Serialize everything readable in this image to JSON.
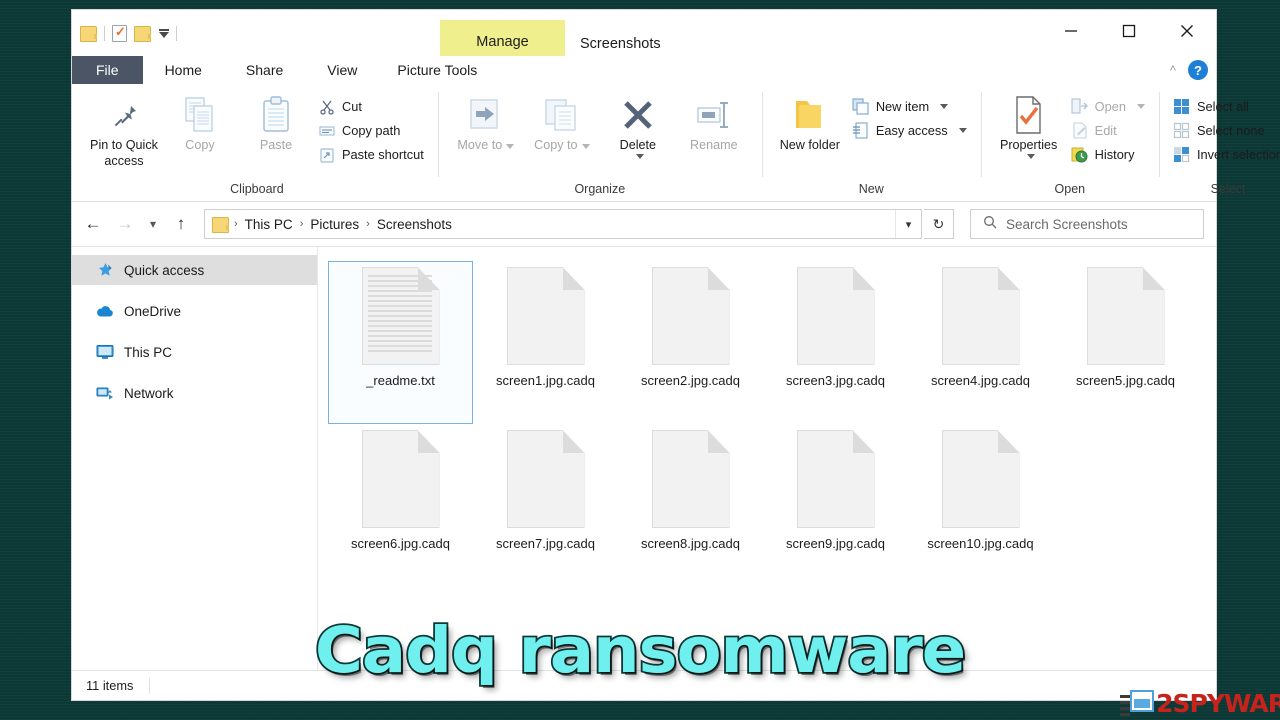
{
  "window": {
    "title": "Screenshots",
    "manage_band": "Manage",
    "controls": {
      "minimize": "minimize-button",
      "maximize": "maximize-button",
      "close": "close-button"
    },
    "quick_access": [
      {
        "name": "folder-icon"
      },
      {
        "name": "properties-icon"
      },
      {
        "name": "folder-icon"
      },
      {
        "name": "customize-dropdown-icon"
      }
    ]
  },
  "tabs": [
    {
      "label": "File",
      "type": "file"
    },
    {
      "label": "Home",
      "type": "tab",
      "active": true
    },
    {
      "label": "Share",
      "type": "tab"
    },
    {
      "label": "View",
      "type": "tab"
    },
    {
      "label": "Picture Tools",
      "type": "contextual"
    }
  ],
  "ribbon": {
    "collapse_icon": "chevron-up-icon",
    "help_icon": "help-icon",
    "help_label": "?",
    "groups": [
      {
        "label": "Clipboard",
        "big": [
          {
            "label": "Pin to Quick access",
            "icon": "pin-icon"
          },
          {
            "label": "Copy",
            "icon": "copy-icon",
            "dim": true
          },
          {
            "label": "Paste",
            "icon": "paste-icon",
            "dim": true
          }
        ],
        "small": [
          {
            "label": "Cut",
            "icon": "scissors-icon"
          },
          {
            "label": "Copy path",
            "icon": "copy-path-icon"
          },
          {
            "label": "Paste shortcut",
            "icon": "paste-shortcut-icon"
          }
        ]
      },
      {
        "label": "Organize",
        "big": [
          {
            "label": "Move to",
            "icon": "move-to-icon",
            "dim": true,
            "caret": true
          },
          {
            "label": "Copy to",
            "icon": "copy-to-icon",
            "dim": true,
            "caret": true
          },
          {
            "label": "Delete",
            "icon": "delete-icon",
            "caret_below": true
          },
          {
            "label": "Rename",
            "icon": "rename-icon",
            "dim": true
          }
        ]
      },
      {
        "label": "New",
        "big": [
          {
            "label": "New folder",
            "icon": "new-folder-icon"
          }
        ],
        "small": [
          {
            "label": "New item",
            "icon": "new-item-icon",
            "caret": true
          },
          {
            "label": "Easy access",
            "icon": "easy-access-icon",
            "caret": true
          }
        ]
      },
      {
        "label": "Open",
        "big": [
          {
            "label": "Properties",
            "icon": "properties-icon",
            "caret_below": true
          }
        ],
        "small": [
          {
            "label": "Open",
            "icon": "open-icon",
            "dim": true,
            "caret": true
          },
          {
            "label": "Edit",
            "icon": "edit-icon",
            "dim": true
          },
          {
            "label": "History",
            "icon": "history-icon"
          }
        ]
      },
      {
        "label": "Select",
        "small": [
          {
            "label": "Select all",
            "icon": "select-all-icon"
          },
          {
            "label": "Select none",
            "icon": "select-none-icon"
          },
          {
            "label": "Invert selection",
            "icon": "invert-selection-icon"
          }
        ]
      }
    ]
  },
  "addressbar": {
    "back_icon": "back-arrow-icon",
    "forward_icon": "forward-arrow-icon",
    "recent_icon": "recent-locations-icon",
    "up_icon": "up-arrow-icon",
    "folder_icon": "folder-icon",
    "breadcrumbs": [
      "This PC",
      "Pictures",
      "Screenshots"
    ],
    "separator": "›",
    "dropdown_icon": "chevron-down-icon",
    "refresh_icon": "refresh-icon",
    "search": {
      "icon": "search-icon",
      "placeholder": "Search Screenshots",
      "value": ""
    }
  },
  "sidebar": {
    "items": [
      {
        "label": "Quick access",
        "icon": "star-pin-icon",
        "selected": true
      },
      {
        "label": "OneDrive",
        "icon": "cloud-icon"
      },
      {
        "label": "This PC",
        "icon": "monitor-icon"
      },
      {
        "label": "Network",
        "icon": "network-icon"
      }
    ]
  },
  "files": [
    {
      "name": "_readme.txt",
      "icon": "text-document-icon",
      "selected": true
    },
    {
      "name": "screen1.jpg.cadq",
      "icon": "blank-document-icon"
    },
    {
      "name": "screen2.jpg.cadq",
      "icon": "blank-document-icon"
    },
    {
      "name": "screen3.jpg.cadq",
      "icon": "blank-document-icon"
    },
    {
      "name": "screen4.jpg.cadq",
      "icon": "blank-document-icon"
    },
    {
      "name": "screen5.jpg.cadq",
      "icon": "blank-document-icon"
    },
    {
      "name": "screen6.jpg.cadq",
      "icon": "blank-document-icon"
    },
    {
      "name": "screen7.jpg.cadq",
      "icon": "blank-document-icon"
    },
    {
      "name": "screen8.jpg.cadq",
      "icon": "blank-document-icon"
    },
    {
      "name": "screen9.jpg.cadq",
      "icon": "blank-document-icon"
    },
    {
      "name": "screen10.jpg.cadq",
      "icon": "blank-document-icon"
    }
  ],
  "statusbar": {
    "item_count": "11 items"
  },
  "overlay": {
    "banner_text": "Cadq ransomware"
  },
  "watermark": {
    "text": "2SPYWAR",
    "icon": "news-article-icon"
  },
  "colors": {
    "backdrop": "#0c3936",
    "file_tab": "#4b5565",
    "manage_band": "#f0ef8d",
    "selection": "#7cb0dd",
    "sidebar_selected": "#dedede",
    "banner_fill": "#6ff0ee",
    "banner_stroke": "#0d3b3a",
    "watermark_red": "#c7221c",
    "help_blue": "#1d7fd6"
  }
}
